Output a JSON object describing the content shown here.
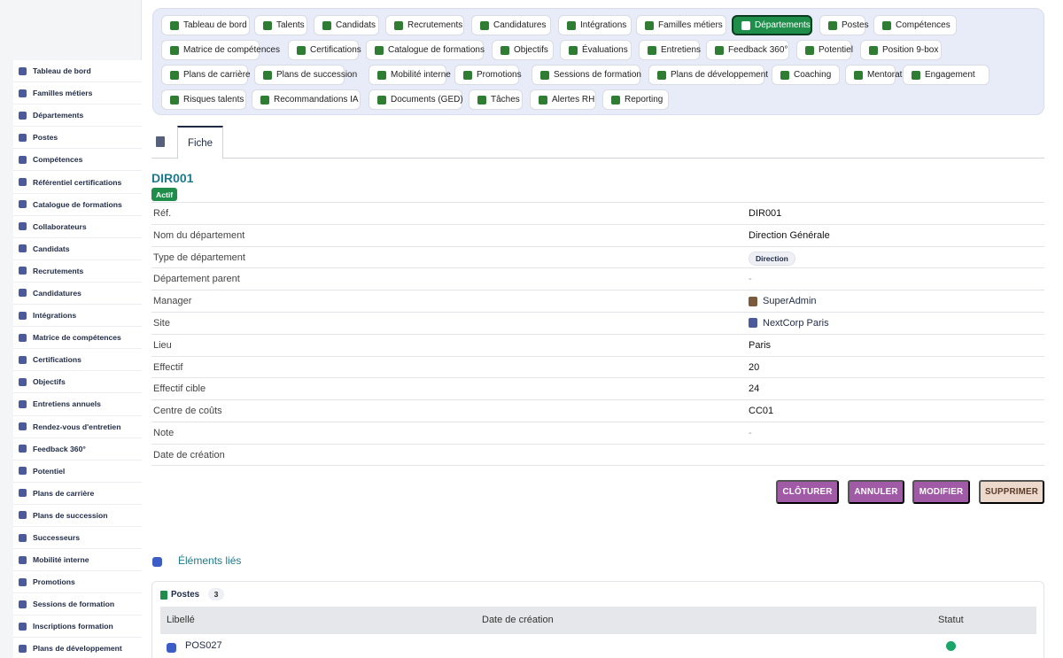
{
  "sidebar": {
    "items": [
      {
        "label": "Tableau de bord",
        "icon": "dashboard-icon"
      },
      {
        "label": "Familles métiers",
        "icon": "hierarchy-icon"
      },
      {
        "label": "Départements",
        "icon": "building-icon"
      },
      {
        "label": "Postes",
        "icon": "badge-icon"
      },
      {
        "label": "Compétences",
        "icon": "brain-icon"
      },
      {
        "label": "Référentiel certifications",
        "icon": "certificate-icon"
      },
      {
        "label": "Catalogue de formations",
        "icon": "graduation-cap-icon"
      },
      {
        "label": "Collaborateurs",
        "icon": "user-icon"
      },
      {
        "label": "Candidats",
        "icon": "user-plus-icon"
      },
      {
        "label": "Recrutements",
        "icon": "megaphone-icon"
      },
      {
        "label": "Candidatures",
        "icon": "file-signature-icon"
      },
      {
        "label": "Intégrations",
        "icon": "door-open-icon"
      },
      {
        "label": "Matrice de compétences",
        "icon": "network-icon"
      },
      {
        "label": "Certifications",
        "icon": "award-icon"
      },
      {
        "label": "Objectifs",
        "icon": "target-icon"
      },
      {
        "label": "Entretiens annuels",
        "icon": "star-icon"
      },
      {
        "label": "Rendez-vous d'entretien",
        "icon": "chat-icon"
      },
      {
        "label": "Feedback 360°",
        "icon": "comment-icon"
      },
      {
        "label": "Potentiel",
        "icon": "chart-line-icon"
      },
      {
        "label": "Plans de carrière",
        "icon": "career-icon"
      },
      {
        "label": "Plans de succession",
        "icon": "sitemap-icon"
      },
      {
        "label": "Successeurs",
        "icon": "users-icon"
      },
      {
        "label": "Mobilité interne",
        "icon": "exchange-icon"
      },
      {
        "label": "Promotions",
        "icon": "arrow-up-icon"
      },
      {
        "label": "Sessions de formation",
        "icon": "chalkboard-icon"
      },
      {
        "label": "Inscriptions formation",
        "icon": "signup-icon"
      },
      {
        "label": "Plans de développement",
        "icon": "clipboard-icon"
      }
    ]
  },
  "topnav": {
    "rows": [
      [
        {
          "label": "Tableau de bord",
          "icon": "dashboard-icon"
        },
        {
          "label": "Talents",
          "icon": "user-icon"
        },
        {
          "label": "Candidats",
          "icon": "user-plus-icon"
        },
        {
          "label": "Recrutements",
          "icon": "megaphone-icon"
        },
        {
          "label": "Candidatures",
          "icon": "file-signature-icon"
        },
        {
          "label": "Intégrations",
          "icon": "door-open-icon"
        },
        {
          "label": "Familles métiers",
          "icon": "hierarchy-icon"
        },
        {
          "label": "Départements",
          "icon": "building-icon",
          "active": true
        },
        {
          "label": "Postes",
          "icon": "badge-icon"
        },
        {
          "label": "Compétences",
          "icon": "brain-icon"
        }
      ],
      [
        {
          "label": "Matrice de compétences",
          "icon": "network-icon"
        },
        {
          "label": "Certifications",
          "icon": "award-icon"
        },
        {
          "label": "Catalogue de formations",
          "icon": "graduation-cap-icon"
        },
        {
          "label": "Objectifs",
          "icon": "target-icon"
        },
        {
          "label": "Évaluations",
          "icon": "star-icon"
        },
        {
          "label": "Entretiens",
          "icon": "chat-icon"
        },
        {
          "label": "Feedback 360°",
          "icon": "comment-icon"
        },
        {
          "label": "Potentiel",
          "icon": "chart-line-icon"
        },
        {
          "label": "Position 9-box",
          "icon": "grid-icon"
        }
      ],
      [
        {
          "label": "Plans de carrière",
          "icon": "career-icon"
        },
        {
          "label": "Plans de succession",
          "icon": "sitemap-icon"
        },
        {
          "label": "Mobilité interne",
          "icon": "exchange-icon"
        },
        {
          "label": "Promotions",
          "icon": "arrow-up-icon"
        },
        {
          "label": "Sessions de formation",
          "icon": "chalkboard-icon"
        },
        {
          "label": "Plans de développement",
          "icon": "clipboard-icon"
        },
        {
          "label": "Coaching",
          "icon": "handshake-icon"
        },
        {
          "label": "Mentorat",
          "icon": "mentor-icon"
        },
        {
          "label": "Engagement",
          "icon": "heart-icon"
        }
      ],
      [
        {
          "label": "Risques talents",
          "icon": "warning-icon"
        },
        {
          "label": "Recommandations IA",
          "icon": "robot-icon"
        },
        {
          "label": "Documents (GED)",
          "icon": "folder-icon"
        },
        {
          "label": "Tâches",
          "icon": "tasks-icon"
        },
        {
          "label": "Alertes RH",
          "icon": "bell-icon"
        },
        {
          "label": "Reporting",
          "icon": "pie-chart-icon"
        }
      ]
    ]
  },
  "tabs": {
    "fiche": "Fiche"
  },
  "record": {
    "code": "DIR001",
    "status": "Actif",
    "fields": [
      {
        "label": "Réf.",
        "value": "DIR001"
      },
      {
        "label": "Nom du département",
        "value": "Direction Générale"
      },
      {
        "label": "Type de département",
        "value": "Direction",
        "kind": "badge"
      },
      {
        "label": "Département parent",
        "value": "-",
        "kind": "muted"
      },
      {
        "label": "Manager",
        "value": "SuperAdmin",
        "kind": "link",
        "icon": "user-icon",
        "icon_color": "#7a5a3a"
      },
      {
        "label": "Site",
        "value": "NextCorp Paris",
        "kind": "link",
        "icon": "building-icon",
        "icon_color": "#4a5a9a"
      },
      {
        "label": "Lieu",
        "value": "Paris"
      },
      {
        "label": "Effectif",
        "value": "20"
      },
      {
        "label": "Effectif cible",
        "value": "24"
      },
      {
        "label": "Centre de coûts",
        "value": "CC01"
      },
      {
        "label": "Note",
        "value": "-",
        "kind": "muted"
      },
      {
        "label": "Date de création",
        "value": ""
      }
    ]
  },
  "actions": {
    "cloturer": "CLÔTURER",
    "annuler": "ANNULER",
    "modifier": "MODIFIER",
    "supprimer": "SUPPRIMER"
  },
  "linked": {
    "title": "Éléments liés",
    "postes": {
      "title": "Postes",
      "count": "3",
      "columns": [
        "Libellé",
        "Date de création",
        "Statut"
      ],
      "rows": [
        {
          "code": "POS027",
          "status_color": "#1aa56a"
        }
      ]
    }
  },
  "colors": {
    "accent": "#1e8e4a",
    "action": "#a05aa6",
    "heading": "#1d7a8a"
  }
}
